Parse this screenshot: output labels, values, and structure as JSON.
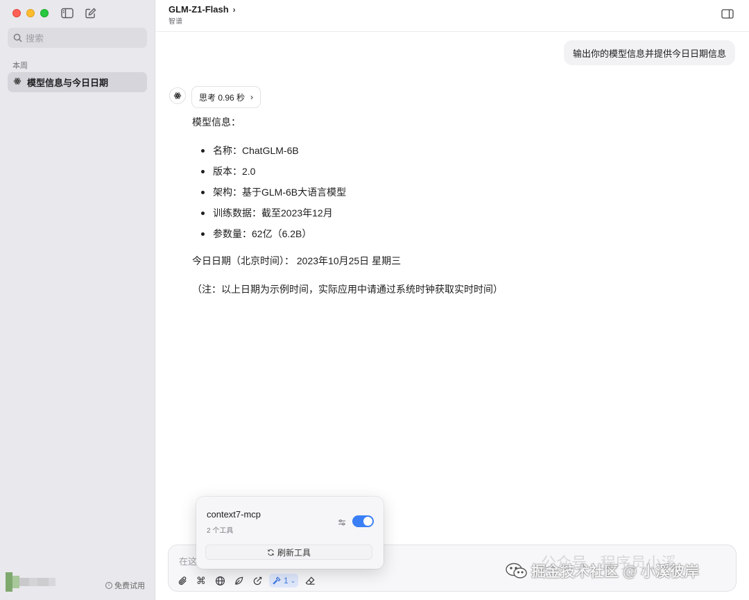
{
  "sidebar": {
    "search_placeholder": "搜索",
    "section_label": "本周",
    "chats": [
      {
        "title": "模型信息与今日日期"
      }
    ],
    "free_trial_label": "免费试用"
  },
  "header": {
    "model_name": "GLM-Z1-Flash",
    "provider": "智谱"
  },
  "conversation": {
    "user_message": "输出你的模型信息并提供今日日期信息",
    "thinking_label": "思考 0.96 秒",
    "answer_heading": "模型信息：",
    "answer_items": [
      "名称：ChatGLM-6B",
      "版本：2.0",
      "架构：基于GLM-6B大语言模型",
      "训练数据：截至2023年12月",
      "参数量：62亿（6.2B）"
    ],
    "date_line": "今日日期（北京时间）： 2023年10月25日 星期三",
    "note": "（注：以上日期为示例时间，实际应用中请通过系统时钟获取实时时间）"
  },
  "composer": {
    "placeholder": "在这",
    "tools_count": "1"
  },
  "mcp_popover": {
    "server_name": "context7-mcp",
    "tool_count": "2 个工具",
    "enabled": true,
    "refresh_label": "刷新工具"
  },
  "watermark": {
    "text": "掘金技术社区 @ 小溪彼岸",
    "faint_text": "公众号 · 程序员小溪"
  },
  "colors": {
    "sidebar_bg": "#e9e8ec",
    "accent": "#3a7ff6",
    "selected_item_bg": "#d6d5db"
  }
}
